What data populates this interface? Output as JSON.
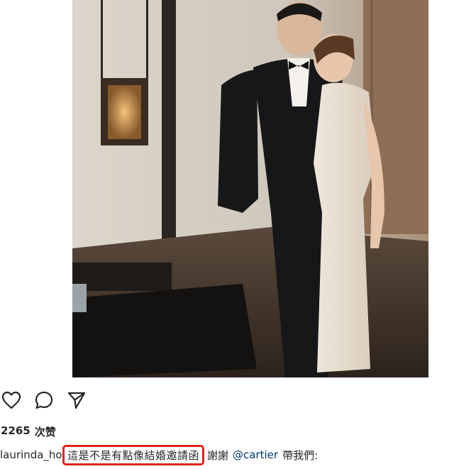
{
  "post": {
    "photo": {
      "alt_icon": "photo-image"
    },
    "actions": {
      "like_icon": "heart-icon",
      "comment_icon": "comment-icon",
      "share_icon": "send-icon"
    },
    "likes": {
      "count": "2265",
      "label": "次赞"
    },
    "caption": {
      "username": "laurinda_ho",
      "highlighted_text": "這是不是有點像結婚邀請函",
      "after_highlight": "謝謝",
      "mention": "@cartier",
      "rest": "帶我們:"
    },
    "colors": {
      "highlight_border": "#e0231c",
      "mention": "#00376b",
      "text": "#262626"
    }
  }
}
